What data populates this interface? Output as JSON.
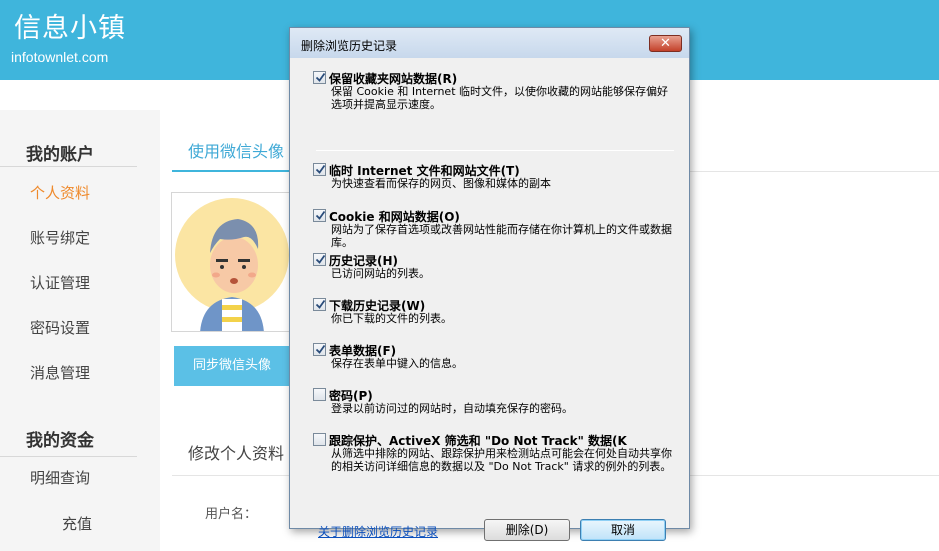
{
  "site": {
    "logo_text": "信息小镇",
    "logo_sub": "infotownlet.com",
    "brand_color": "#3fb5dc",
    "accent_color": "#ef8a2c"
  },
  "sidebar": {
    "account_heading": "我的账户",
    "account_items": [
      "个人资料",
      "账号绑定",
      "认证管理",
      "密码设置",
      "消息管理"
    ],
    "active_item": "个人资料",
    "funds_heading": "我的资金",
    "funds_items": [
      "明细查询",
      "充值"
    ]
  },
  "main": {
    "tab_label": "使用微信头像",
    "sync_button": "同步微信头像",
    "section_title": "修改个人资料",
    "username_label": "用户名："
  },
  "dialog": {
    "title": "删除浏览历史记录",
    "close_glyph": "✕",
    "options": [
      {
        "label": "保留收藏夹网站数据(R)",
        "checked": true,
        "desc": "保留 Cookie 和 Internet 临时文件，以使你收藏的网站能够保存偏好选项并提高显示速度。"
      },
      {
        "label": "临时 Internet 文件和网站文件(T)",
        "checked": true,
        "desc": "为快速查看而保存的网页、图像和媒体的副本"
      },
      {
        "label": "Cookie 和网站数据(O)",
        "checked": true,
        "desc": "网站为了保存首选项或改善网站性能而存储在你计算机上的文件或数据库。"
      },
      {
        "label": "历史记录(H)",
        "checked": true,
        "desc": "已访问网站的列表。"
      },
      {
        "label": "下载历史记录(W)",
        "checked": true,
        "desc": "你已下载的文件的列表。"
      },
      {
        "label": "表单数据(F)",
        "checked": true,
        "desc": "保存在表单中键入的信息。"
      },
      {
        "label": "密码(P)",
        "checked": false,
        "desc": "登录以前访问过的网站时，自动填充保存的密码。"
      },
      {
        "label": "跟踪保护、ActiveX 筛选和 \"Do Not Track\" 数据(K",
        "checked": false,
        "desc": "从筛选中排除的网站、跟踪保护用来检测站点可能会在何处自动共享你的相关访问详细信息的数据以及 \"Do Not Track\" 请求的例外的列表。"
      }
    ],
    "link": "关于删除浏览历史记录",
    "delete_button": "删除(D)",
    "cancel_button": "取消"
  }
}
